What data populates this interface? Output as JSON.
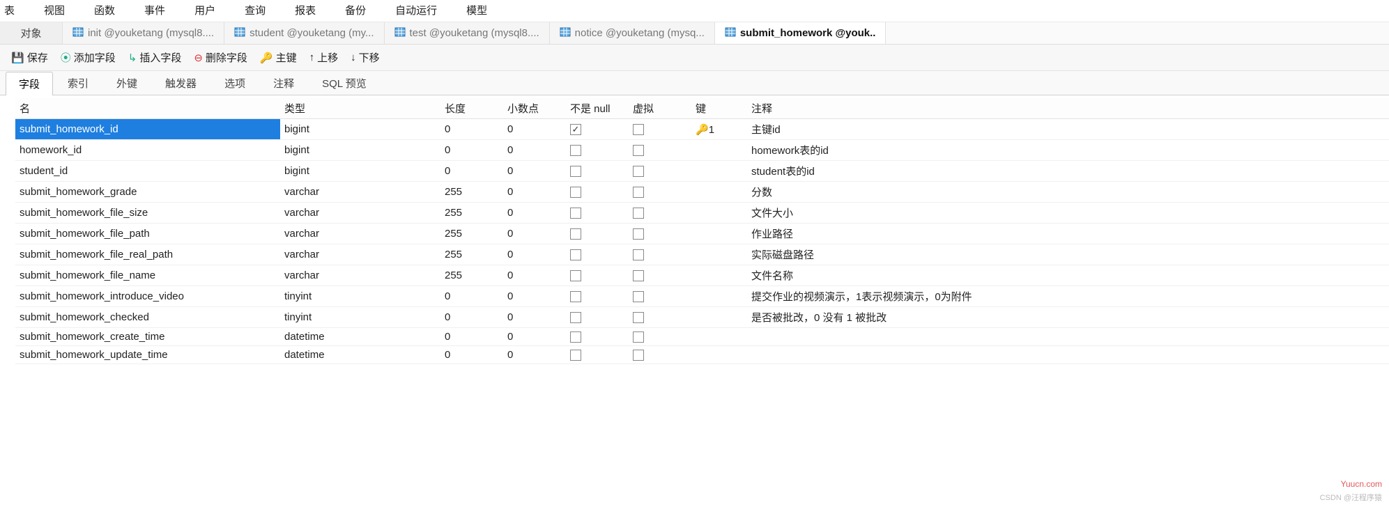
{
  "menu": [
    "表",
    "视图",
    "函数",
    "事件",
    "用户",
    "查询",
    "报表",
    "备份",
    "自动运行",
    "模型"
  ],
  "tabs": {
    "object_label": "对象",
    "items": [
      {
        "label": "init @youketang (mysql8....",
        "active": false
      },
      {
        "label": "student @youketang (my...",
        "active": false
      },
      {
        "label": "test @youketang (mysql8....",
        "active": false
      },
      {
        "label": "notice @youketang (mysq...",
        "active": false
      },
      {
        "label": "submit_homework @youk..",
        "active": true
      }
    ]
  },
  "toolbar": {
    "save": "保存",
    "add_field": "添加字段",
    "insert_field": "插入字段",
    "delete_field": "删除字段",
    "primary_key": "主键",
    "move_up": "上移",
    "move_down": "下移"
  },
  "subtabs": [
    "字段",
    "索引",
    "外键",
    "触发器",
    "选项",
    "注释",
    "SQL 预览"
  ],
  "subtab_active": 0,
  "columns": {
    "name": "名",
    "type": "类型",
    "length": "长度",
    "decimals": "小数点",
    "not_null": "不是 null",
    "virtual": "虚拟",
    "key": "键",
    "comment": "注释"
  },
  "rows": [
    {
      "name": "submit_homework_id",
      "type": "bigint",
      "length": "0",
      "decimals": "0",
      "not_null": true,
      "virtual": false,
      "key": "1",
      "comment": "主键id",
      "selected": true
    },
    {
      "name": "homework_id",
      "type": "bigint",
      "length": "0",
      "decimals": "0",
      "not_null": false,
      "virtual": false,
      "key": "",
      "comment": "homework表的id"
    },
    {
      "name": "student_id",
      "type": "bigint",
      "length": "0",
      "decimals": "0",
      "not_null": false,
      "virtual": false,
      "key": "",
      "comment": "student表的id"
    },
    {
      "name": "submit_homework_grade",
      "type": "varchar",
      "length": "255",
      "decimals": "0",
      "not_null": false,
      "virtual": false,
      "key": "",
      "comment": "分数"
    },
    {
      "name": "submit_homework_file_size",
      "type": "varchar",
      "length": "255",
      "decimals": "0",
      "not_null": false,
      "virtual": false,
      "key": "",
      "comment": "文件大小"
    },
    {
      "name": "submit_homework_file_path",
      "type": "varchar",
      "length": "255",
      "decimals": "0",
      "not_null": false,
      "virtual": false,
      "key": "",
      "comment": "作业路径"
    },
    {
      "name": "submit_homework_file_real_path",
      "type": "varchar",
      "length": "255",
      "decimals": "0",
      "not_null": false,
      "virtual": false,
      "key": "",
      "comment": "实际磁盘路径"
    },
    {
      "name": "submit_homework_file_name",
      "type": "varchar",
      "length": "255",
      "decimals": "0",
      "not_null": false,
      "virtual": false,
      "key": "",
      "comment": "文件名称"
    },
    {
      "name": "submit_homework_introduce_video",
      "type": "tinyint",
      "length": "0",
      "decimals": "0",
      "not_null": false,
      "virtual": false,
      "key": "",
      "comment": "提交作业的视频演示，1表示视频演示，0为附件"
    },
    {
      "name": "submit_homework_checked",
      "type": "tinyint",
      "length": "0",
      "decimals": "0",
      "not_null": false,
      "virtual": false,
      "key": "",
      "comment": "是否被批改，0 没有 1 被批改"
    },
    {
      "name": "submit_homework_create_time",
      "type": "datetime",
      "length": "0",
      "decimals": "0",
      "not_null": false,
      "virtual": false,
      "key": "",
      "comment": ""
    },
    {
      "name": "submit_homework_update_time",
      "type": "datetime",
      "length": "0",
      "decimals": "0",
      "not_null": false,
      "virtual": false,
      "key": "",
      "comment": ""
    }
  ],
  "watermark": "Yuucn.com",
  "credit": "CSDN @汪程序猿"
}
